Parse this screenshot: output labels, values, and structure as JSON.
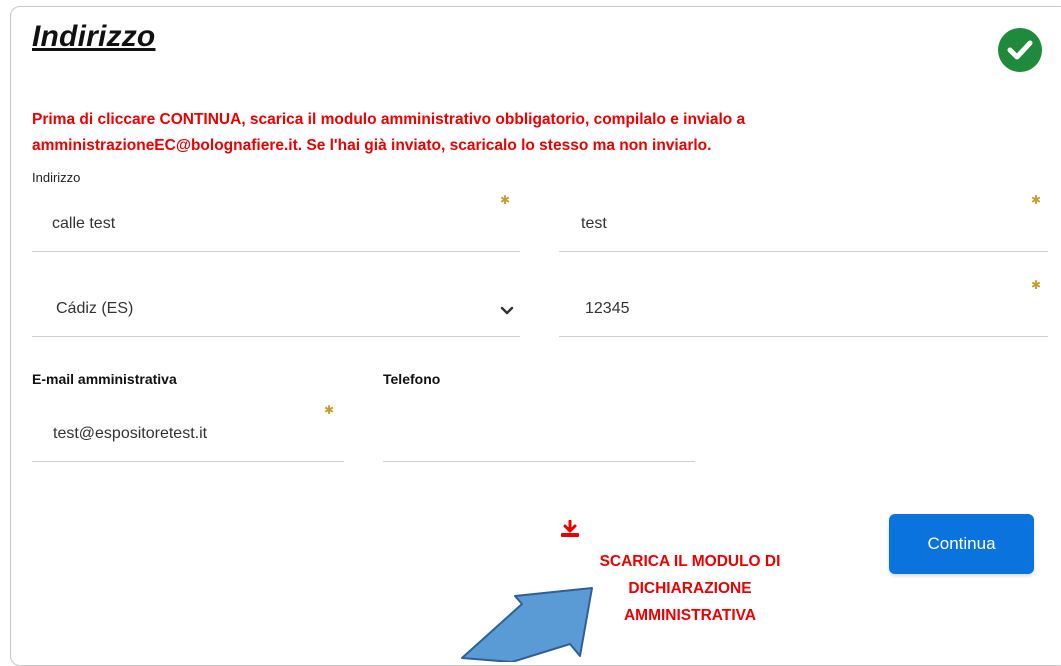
{
  "section": {
    "title": "Indirizzo",
    "notice_line1": "Prima di cliccare CONTINUA, scarica il modulo amministrativo obbligatorio, compilalo e invialo a",
    "notice_line2": "amministrazioneEC@bolognafiere.it. Se l'hai già inviato, scaricalo lo stesso ma non inviarlo.",
    "address_label": "Indirizzo"
  },
  "fields": {
    "street": "calle test",
    "number": "test",
    "province": "Cádiz (ES)",
    "postal_code": "12345",
    "email_label": "E-mail amministrativa",
    "email": "test@espositoretest.it",
    "phone_label": "Telefono",
    "phone": ""
  },
  "required_marker": "✱",
  "actions": {
    "continue_label": "Continua",
    "download_line1": "SCARICA IL MODULO DI",
    "download_line2": "DICHIARAZIONE",
    "download_line3": "AMMINISTRATIVA"
  },
  "icons": {
    "status": "check-circle-icon",
    "download": "download-icon",
    "select": "chevron-down-icon",
    "pointer": "arrow-pointer"
  },
  "colors": {
    "accent": "#0b73de",
    "warning_text": "#ee0000",
    "success": "#1f8a3c",
    "required": "#c89b2a",
    "arrow_fill": "#5b9bd5"
  }
}
